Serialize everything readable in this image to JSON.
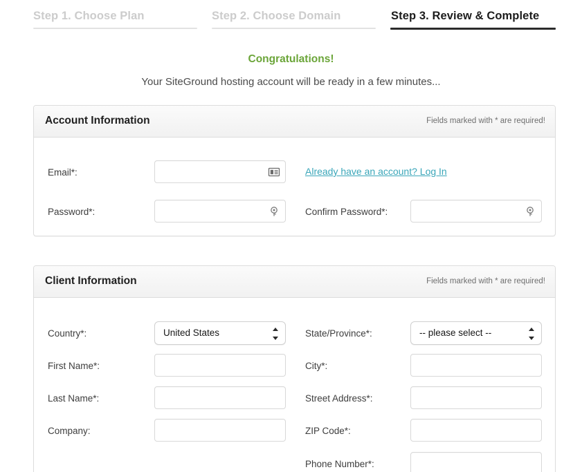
{
  "steps": [
    {
      "label": "Step 1. Choose Plan",
      "state": "inactive"
    },
    {
      "label": "Step 2. Choose Domain",
      "state": "inactive"
    },
    {
      "label": "Step 3. Review & Complete",
      "state": "active"
    }
  ],
  "banner": {
    "congrats": "Congratulations!",
    "subtitle": "Your SiteGround hosting account will be ready in a few minutes...",
    "congrats_color": "#6ba539"
  },
  "account_panel": {
    "title": "Account Information",
    "required_note": "Fields marked with * are required!",
    "email_label": "Email*:",
    "email_value": "",
    "email_icon": "contact-card-icon",
    "login_link": "Already have an account? Log In",
    "login_link_color": "#3aa6b9",
    "password_label": "Password*:",
    "password_value": "",
    "password_icon": "key-icon",
    "confirm_password_label": "Confirm Password*:",
    "confirm_password_value": "",
    "confirm_password_icon": "key-icon"
  },
  "client_panel": {
    "title": "Client Information",
    "required_note": "Fields marked with * are required!",
    "country_label": "Country*:",
    "country_value": "United States",
    "state_label": "State/Province*:",
    "state_value": "-- please select --",
    "first_name_label": "First Name*:",
    "first_name_value": "",
    "city_label": "City*:",
    "city_value": "",
    "last_name_label": "Last Name*:",
    "last_name_value": "",
    "street_label": "Street Address*:",
    "street_value": "",
    "company_label": "Company:",
    "company_value": "",
    "zip_label": "ZIP Code*:",
    "zip_value": "",
    "phone_label": "Phone Number*:",
    "phone_value": ""
  }
}
